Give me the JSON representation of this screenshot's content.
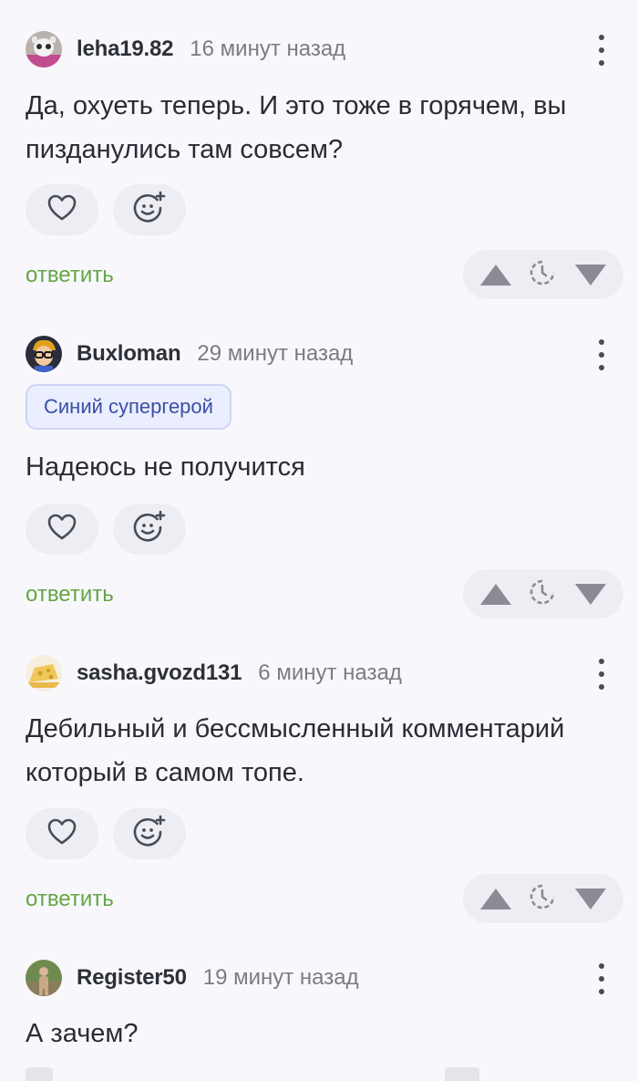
{
  "comments": [
    {
      "username": "leha19.82",
      "time": "16 минут назад",
      "text": "Да, охуеть теперь. И это тоже в горячем, вы пизданулись там совсем?",
      "reply_label": "ответить"
    },
    {
      "username": "Buxloman",
      "time": "29 минут назад",
      "badge": "Синий супергерой",
      "text": "Надеюсь не получится",
      "reply_label": "ответить"
    },
    {
      "username": "sasha.gvozd131",
      "time": "6 минут назад",
      "text": "Дебильный и бессмысленный комментарий который в самом топе.",
      "reply_label": "ответить"
    },
    {
      "username": "Register50",
      "time": "19 минут назад",
      "text": "А зачем?"
    }
  ],
  "colors": {
    "reply": "#64a544",
    "badge_text": "#3a4fa5",
    "badge_bg": "#eaeefe",
    "icon": "#8a8b93"
  },
  "icons": {
    "like": "heart-icon",
    "react": "smiley-add-icon",
    "upvote": "arrow-up-icon",
    "later": "clock-icon",
    "downvote": "arrow-down-icon",
    "menu": "more-vertical-icon"
  }
}
